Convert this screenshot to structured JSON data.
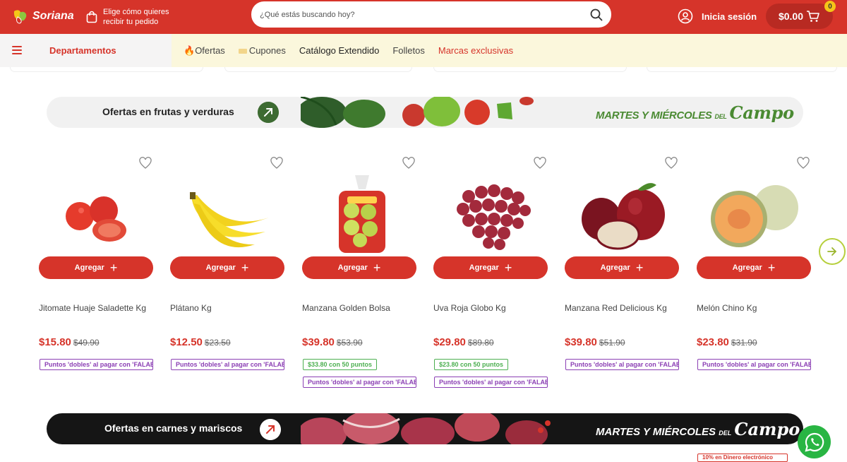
{
  "header": {
    "logo_text": "Soriana",
    "pickup_text": "Elige cómo quieres recibir tu pedido",
    "search_placeholder": "¿Qué estás buscando hoy?",
    "login_label": "Inicia sesión",
    "cart_total": "$0.00",
    "cart_count": "0"
  },
  "nav": {
    "departments_label": "Departamentos",
    "items": [
      {
        "label": "Ofertas",
        "icon": "fire-icon"
      },
      {
        "label": "Cupones",
        "icon": "coupon-icon"
      },
      {
        "label": "Catálogo Extendido"
      },
      {
        "label": "Folletos"
      },
      {
        "label": "Marcas exclusivas"
      }
    ]
  },
  "banner_fruits": {
    "title": "Ofertas en frutas y verduras",
    "campaign": "MARTES Y MIÉRCOLES",
    "campaign_small": "DEL",
    "campaign_script": "Campo"
  },
  "products": [
    {
      "name": "Jitomate Huaje Saladette Kg",
      "price": "$15.80",
      "old_price": "$49.90",
      "add_label": "Agregar",
      "tags": [
        {
          "text": "Puntos 'dobles' al pagar con 'FALABELLA'",
          "color": "purple"
        }
      ]
    },
    {
      "name": "Plátano Kg",
      "price": "$12.50",
      "old_price": "$23.50",
      "add_label": "Agregar",
      "tags": [
        {
          "text": "Puntos 'dobles' al pagar con 'FALABELLA'",
          "color": "purple"
        }
      ]
    },
    {
      "name": "Manzana Golden Bolsa",
      "price": "$39.80",
      "old_price": "$53.90",
      "add_label": "Agregar",
      "tags": [
        {
          "text": "$33.80 con 50 puntos",
          "color": "green"
        },
        {
          "text": "Puntos 'dobles' al pagar con 'FALABELLA'",
          "color": "purple"
        }
      ]
    },
    {
      "name": "Uva Roja Globo Kg",
      "price": "$29.80",
      "old_price": "$89.80",
      "add_label": "Agregar",
      "tags": [
        {
          "text": "$23.80 con 50 puntos",
          "color": "green"
        },
        {
          "text": "Puntos 'dobles' al pagar con 'FALABELLA'",
          "color": "purple"
        }
      ]
    },
    {
      "name": "Manzana Red Delicious Kg",
      "price": "$39.80",
      "old_price": "$51.90",
      "add_label": "Agregar",
      "tags": [
        {
          "text": "Puntos 'dobles' al pagar con 'FALABELLA'",
          "color": "purple"
        }
      ]
    },
    {
      "name": "Melón Chino Kg",
      "price": "$23.80",
      "old_price": "$31.90",
      "add_label": "Agregar",
      "tags": [
        {
          "text": "Puntos 'dobles' al pagar con 'FALABELLA'",
          "color": "purple"
        }
      ]
    }
  ],
  "banner_meat": {
    "title": "Ofertas en carnes y mariscos",
    "campaign": "MARTES Y MIÉRCOLES",
    "campaign_small": "DEL",
    "campaign_script": "Campo"
  },
  "promo_peek": "10% en Dinero electrónico",
  "colors": {
    "brand_red": "#d6342a",
    "nav_bg": "#fbf7dc",
    "campo_green": "#4a8a32",
    "tag_purple": "#8b3fb4",
    "tag_green": "#4caf50",
    "whatsapp_green": "#29b543"
  }
}
